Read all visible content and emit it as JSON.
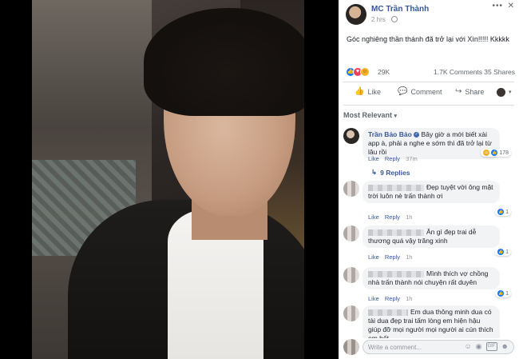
{
  "post": {
    "author": "MC Trần Thành",
    "time": "2 hrs",
    "text": "Góc nghiêng thần thánh đã trở lại với Xìn!!!!! Kkkkk",
    "reactions_count": "29K",
    "comments_count": "1.7K Comments",
    "shares_count": "35 Shares"
  },
  "actions": {
    "like": "Like",
    "comment": "Comment",
    "share": "Share"
  },
  "sort_label": "Most Relevant",
  "comments": [
    {
      "author": "Trần Bảo Bảo",
      "text": "Bây giờ a mới biết xài app à, phải a nghe e sớm thì đã trở lại từ lâu rồi",
      "like": "Like",
      "reply": "Reply",
      "time": "37m",
      "reactions": "178",
      "replies": "9 Replies"
    },
    {
      "text": "Đẹp tuyệt vời ông mặt trời luôn nè trấn thành ơi",
      "like": "Like",
      "reply": "Reply",
      "time": "1h",
      "reactions": "1"
    },
    {
      "text": "Ăn gì đẹp trai dễ thương quá vậy trăng xinh",
      "like": "Like",
      "reply": "Reply",
      "time": "1h",
      "reactions": "1"
    },
    {
      "text": "Mình thích vợ chồng nhà trấn thành nói chuyện rất duyên",
      "like": "Like",
      "reply": "Reply",
      "time": "1h",
      "reactions": "1"
    },
    {
      "text": "Em dua thông minh dua có tài dua đẹp trai tấm lòng em hiện hậu giúp đỡ mọi người mọi người ai cún thích em hết"
    }
  ],
  "write_comment_placeholder": "Write a comment...",
  "icons": {
    "globe": "globe-icon",
    "more": "more-icon",
    "close": "close-icon",
    "like": "thumbs-up-icon",
    "comment": "comment-icon",
    "share": "share-icon",
    "replies": "reply-arrow-icon",
    "emoji": "emoji-icon",
    "camera": "camera-icon",
    "gif": "gif-icon",
    "sticker": "sticker-icon"
  },
  "colors": {
    "link": "#385898",
    "like_blue": "#1877f2",
    "love_red": "#f33e58",
    "haha_yellow": "#f7b125"
  }
}
